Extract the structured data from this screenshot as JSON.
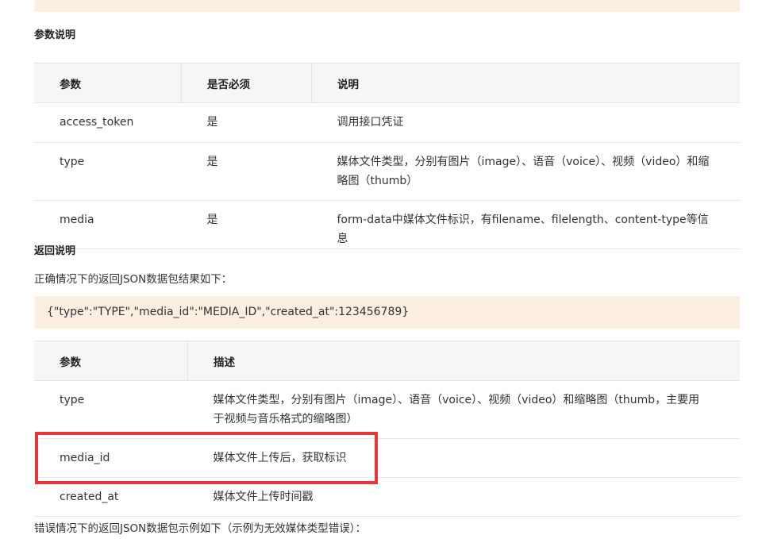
{
  "params_heading": "参数说明",
  "params_table": {
    "headers": [
      "参数",
      "是否必须",
      "说明"
    ],
    "rows": [
      {
        "param": "access_token",
        "required": "是",
        "desc": "调用接口凭证"
      },
      {
        "param": "type",
        "required": "是",
        "desc": "媒体文件类型，分别有图片（image）、语音（voice）、视频（video）和缩略图（thumb）"
      },
      {
        "param": "media",
        "required": "是",
        "desc": "form-data中媒体文件标识，有filename、filelength、content-type等信息"
      }
    ]
  },
  "return_heading": "返回说明",
  "success_intro": "正确情况下的返回JSON数据包结果如下：",
  "success_json": "{\"type\":\"TYPE\",\"media_id\":\"MEDIA_ID\",\"created_at\":123456789}",
  "return_table": {
    "headers": [
      "参数",
      "描述"
    ],
    "rows": [
      {
        "param": "type",
        "desc": "媒体文件类型，分别有图片（image）、语音（voice）、视频（video）和缩略图（thumb，主要用于视频与音乐格式的缩略图）"
      },
      {
        "param": "media_id",
        "desc": "媒体文件上传后，获取标识"
      },
      {
        "param": "created_at",
        "desc": "媒体文件上传时间戳"
      }
    ]
  },
  "error_intro": "错误情况下的返回JSON数据包示例如下（示例为无效媒体类型错误）：",
  "colors": {
    "code_bg": "#fcefe2",
    "header_bg": "#f5f6f7",
    "highlight": "#e8373a"
  }
}
